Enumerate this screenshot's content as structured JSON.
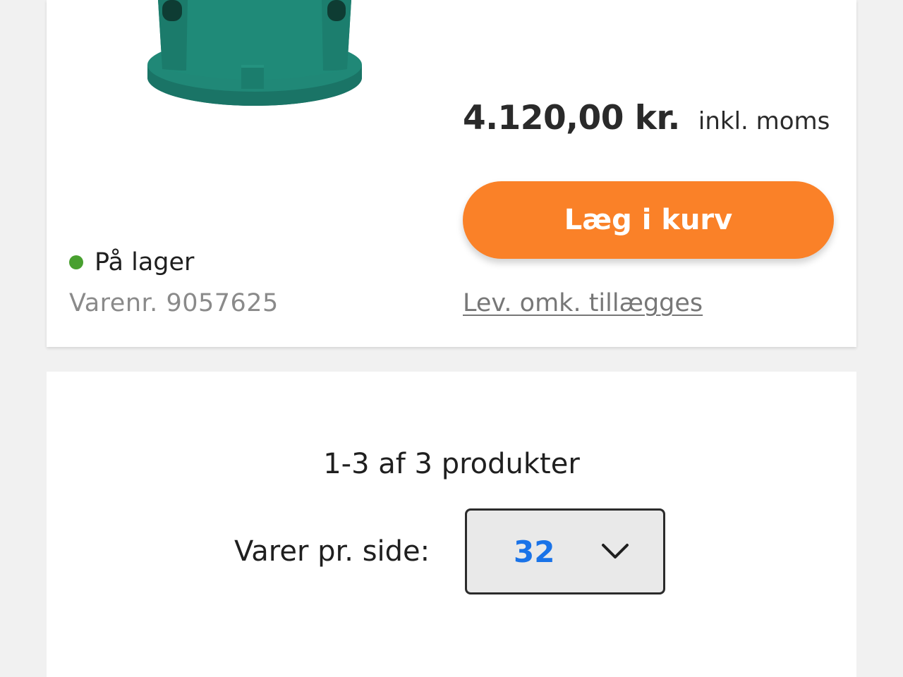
{
  "product": {
    "image_alt": "Grøn beholder",
    "stock_status": "På lager",
    "sku": "Varenr. 9057625",
    "price": "4.120,00 kr.",
    "vat_note": "inkl. moms",
    "add_to_cart_label": "Læg i kurv",
    "delivery_note": "Lev. omk. tillægges"
  },
  "listing": {
    "result_count": "1-3 af 3 produkter",
    "per_page_label": "Varer pr. side:",
    "per_page_value": "32"
  },
  "colors": {
    "accent_orange": "#fa8128",
    "in_stock_green": "#48a02f",
    "select_value_blue": "#1a73e8",
    "product_teal": "#1f8a78"
  },
  "icons": {
    "stock_indicator": "in-stock-dot-icon",
    "select_toggle": "chevron-down-icon"
  }
}
